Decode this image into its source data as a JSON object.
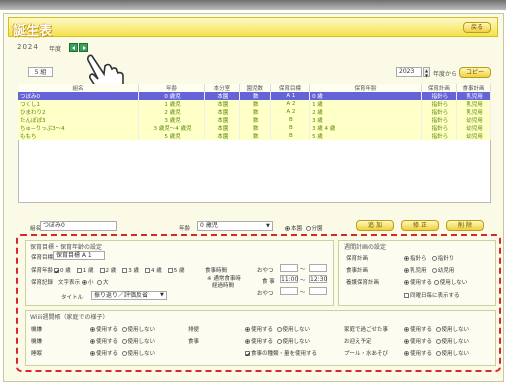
{
  "title": "誕生表",
  "back_label": "戻る",
  "year": "2024",
  "year_suffix": "年度",
  "age_group": "5 組",
  "fy_year": "2023",
  "fy_suffix": "年度から",
  "copy_label": "コピー",
  "columns": [
    "組名",
    "年齢",
    "本分室",
    "園児数",
    "保育目標",
    "保育年齢",
    "保育計画",
    "食事計画"
  ],
  "rows": [
    [
      "つぼみ0",
      "0 歳児",
      "本園",
      "数",
      "A 1",
      "0 歳",
      "指針ら",
      "乳児用"
    ],
    [
      "つくし1",
      "1 歳児",
      "本園",
      "数",
      "A 2",
      "1 歳",
      "指針ら",
      "乳児用"
    ],
    [
      "ひまわり2",
      "2 歳児",
      "本園",
      "数",
      "A 2",
      "2 歳",
      "指針ら",
      "乳児用"
    ],
    [
      "たんぽぽ3",
      "3 歳児",
      "本園",
      "数",
      "B",
      "3 歳",
      "指針ら",
      "幼児用"
    ],
    [
      "ちゅ−りっぷ3～4",
      "3 歳児～4 歳児",
      "本園",
      "数",
      "B",
      "3 歳 4 歳",
      "指針ら",
      "幼児用"
    ],
    [
      "ももち",
      "5 歳児",
      "本園",
      "数",
      "B",
      "5 歳",
      "指針ら",
      "幼児用"
    ]
  ],
  "form": {
    "name_label": "組名",
    "name_value": "つぼみ0",
    "age_label": "年齢",
    "age_value": "0 歳児",
    "main_room": "本園",
    "sub_room": "分園",
    "add_label": "追 加",
    "edit_label": "修 正",
    "delete_label": "削 除"
  },
  "plan_section": {
    "title": "保育目標・保育年齢の設定",
    "goal_label": "保育目標",
    "goal_value": "保育目標 A 1",
    "age_label": "保育年齢",
    "ages": [
      "0 歳",
      "1 歳",
      "2 歳",
      "3 歳",
      "4 歳",
      "5 歳"
    ],
    "meal_time_label": "食事時間",
    "snack_am": "おやつ",
    "note_meal": "※ 通常食事時",
    "note_time": "経過時間",
    "meal_label": "食 事",
    "meal_from": "11:00",
    "meal_to": "12:30",
    "snack_pm": "おやつ",
    "record_label": "保育記録",
    "font_label": "文字表示",
    "font_small": "小",
    "font_large": "大",
    "title_label": "タイトル",
    "title_value": "振り返り／評価反省"
  },
  "meal_section": {
    "title": "週間計画の設定",
    "plan_label": "保育計画",
    "plan_opt1": "指針ら",
    "plan_opt2": "指針り",
    "meal_label": "食事計画",
    "meal_opt1": "乳児用",
    "meal_opt2": "幼児用",
    "eval_label": "養護保育計画",
    "use": "使用する",
    "nouse": "使用しない",
    "print_label": "同曜日毎に表示する"
  },
  "weekly_section": {
    "title": "Wiiii週間帳（家庭での様子）",
    "rows": [
      {
        "label": "機嫌",
        "col2": "排便",
        "col3": "家庭で過ごせた事"
      },
      {
        "label": "機嫌",
        "col2": "食事",
        "col3": "お迎え予定"
      },
      {
        "label": "睡眠",
        "col2": "食事の種類・量を使用する",
        "col3": "プール・水あそび"
      }
    ],
    "use": "使用する",
    "nouse": "使用しない"
  }
}
